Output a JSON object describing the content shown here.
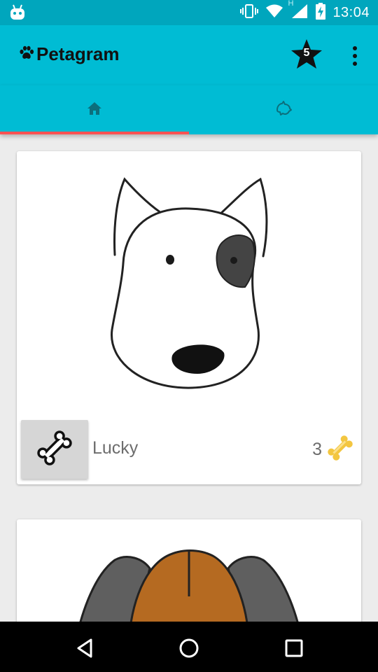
{
  "status_bar": {
    "time": "13:04",
    "network_label": "H",
    "icons": [
      "android-icon",
      "vibrate-icon",
      "wifi-icon",
      "signal-icon",
      "battery-charging-icon"
    ]
  },
  "app_bar": {
    "title": "Petagram",
    "logo_icon": "paw-icon",
    "favorites_count": "5",
    "menu_icon": "more-vert-icon"
  },
  "tabs": [
    {
      "icon": "home-icon",
      "selected": true
    },
    {
      "icon": "dog-icon",
      "selected": false
    }
  ],
  "colors": {
    "primary": "#00bcd4",
    "primary_dark": "#00a6bd",
    "accent": "#ff5252",
    "card": "#ffffff",
    "background": "#ececec"
  },
  "pets": [
    {
      "name": "Lucky",
      "likes": "3",
      "like_button_icon": "bone-icon",
      "like_count_icon": "bone-icon"
    },
    {
      "name": "",
      "likes": ""
    }
  ],
  "nav_bar": {
    "buttons": [
      "back-icon",
      "home-circle-icon",
      "recents-icon"
    ]
  }
}
